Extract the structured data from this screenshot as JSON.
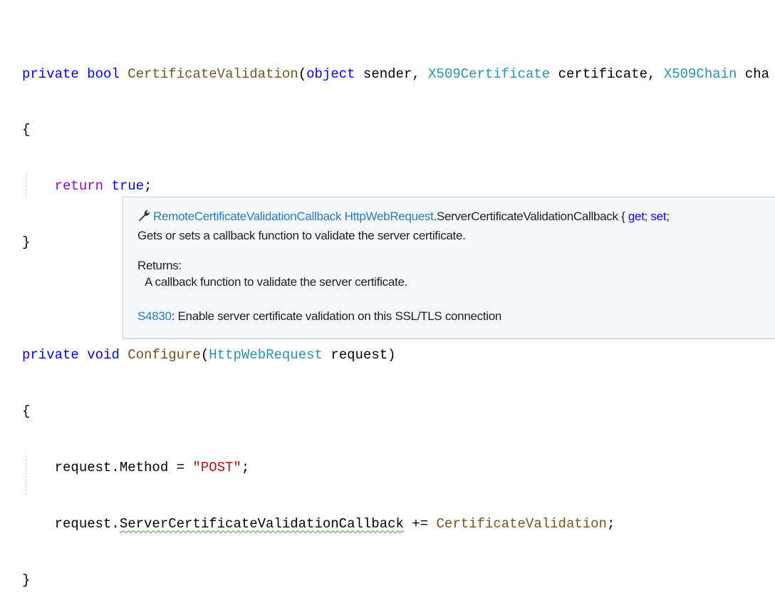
{
  "code": {
    "line1": {
      "kw1": "private",
      "kw2": "bool",
      "method": "CertificateValidation",
      "p1": "(",
      "kw3": "object",
      "t1": " sender, ",
      "type1": "X509Certificate",
      "t2": " certificate, ",
      "type2": "X509Chain",
      "t3": " cha"
    },
    "line2": "{",
    "line3": {
      "kw": "return",
      "val": "true",
      "end": ";"
    },
    "line4": "}",
    "line6": {
      "kw1": "private",
      "kw2": "void",
      "method": "Configure",
      "p1": "(",
      "type": "HttpWebRequest",
      "t1": " request)"
    },
    "line7": "{",
    "line8": {
      "t1": "request.Method = ",
      "str": "\"POST\"",
      "end": ";"
    },
    "line9": {
      "t1": "request.",
      "prop": "ServerCertificateValidationCallback",
      "t2": " += ",
      "method": "CertificateValidation",
      "end": ";"
    },
    "line10": "}"
  },
  "tooltip": {
    "icon": "wrench-icon",
    "sig_type": "RemoteCertificateValidationCallback",
    "sig_class": "HttpWebRequest",
    "sig_member": ".ServerCertificateValidationCallback { ",
    "sig_get": "get",
    "sig_sep": "; ",
    "sig_set": "set",
    "sig_end": ";",
    "summary": "Gets or sets a callback function to validate the server certificate.",
    "returns_label": "Returns:",
    "returns_text": "A callback function to validate the server certificate.",
    "rule_id": "S4830",
    "rule_text": ": Enable server certificate validation on this SSL/TLS connection"
  },
  "colors": {
    "keyword": "#0000ff",
    "control": "#8f08c4",
    "method": "#74531f",
    "type": "#2b91af",
    "string": "#a31515",
    "link": "#2b7bb9",
    "squiggle": "#3c9a3c"
  }
}
